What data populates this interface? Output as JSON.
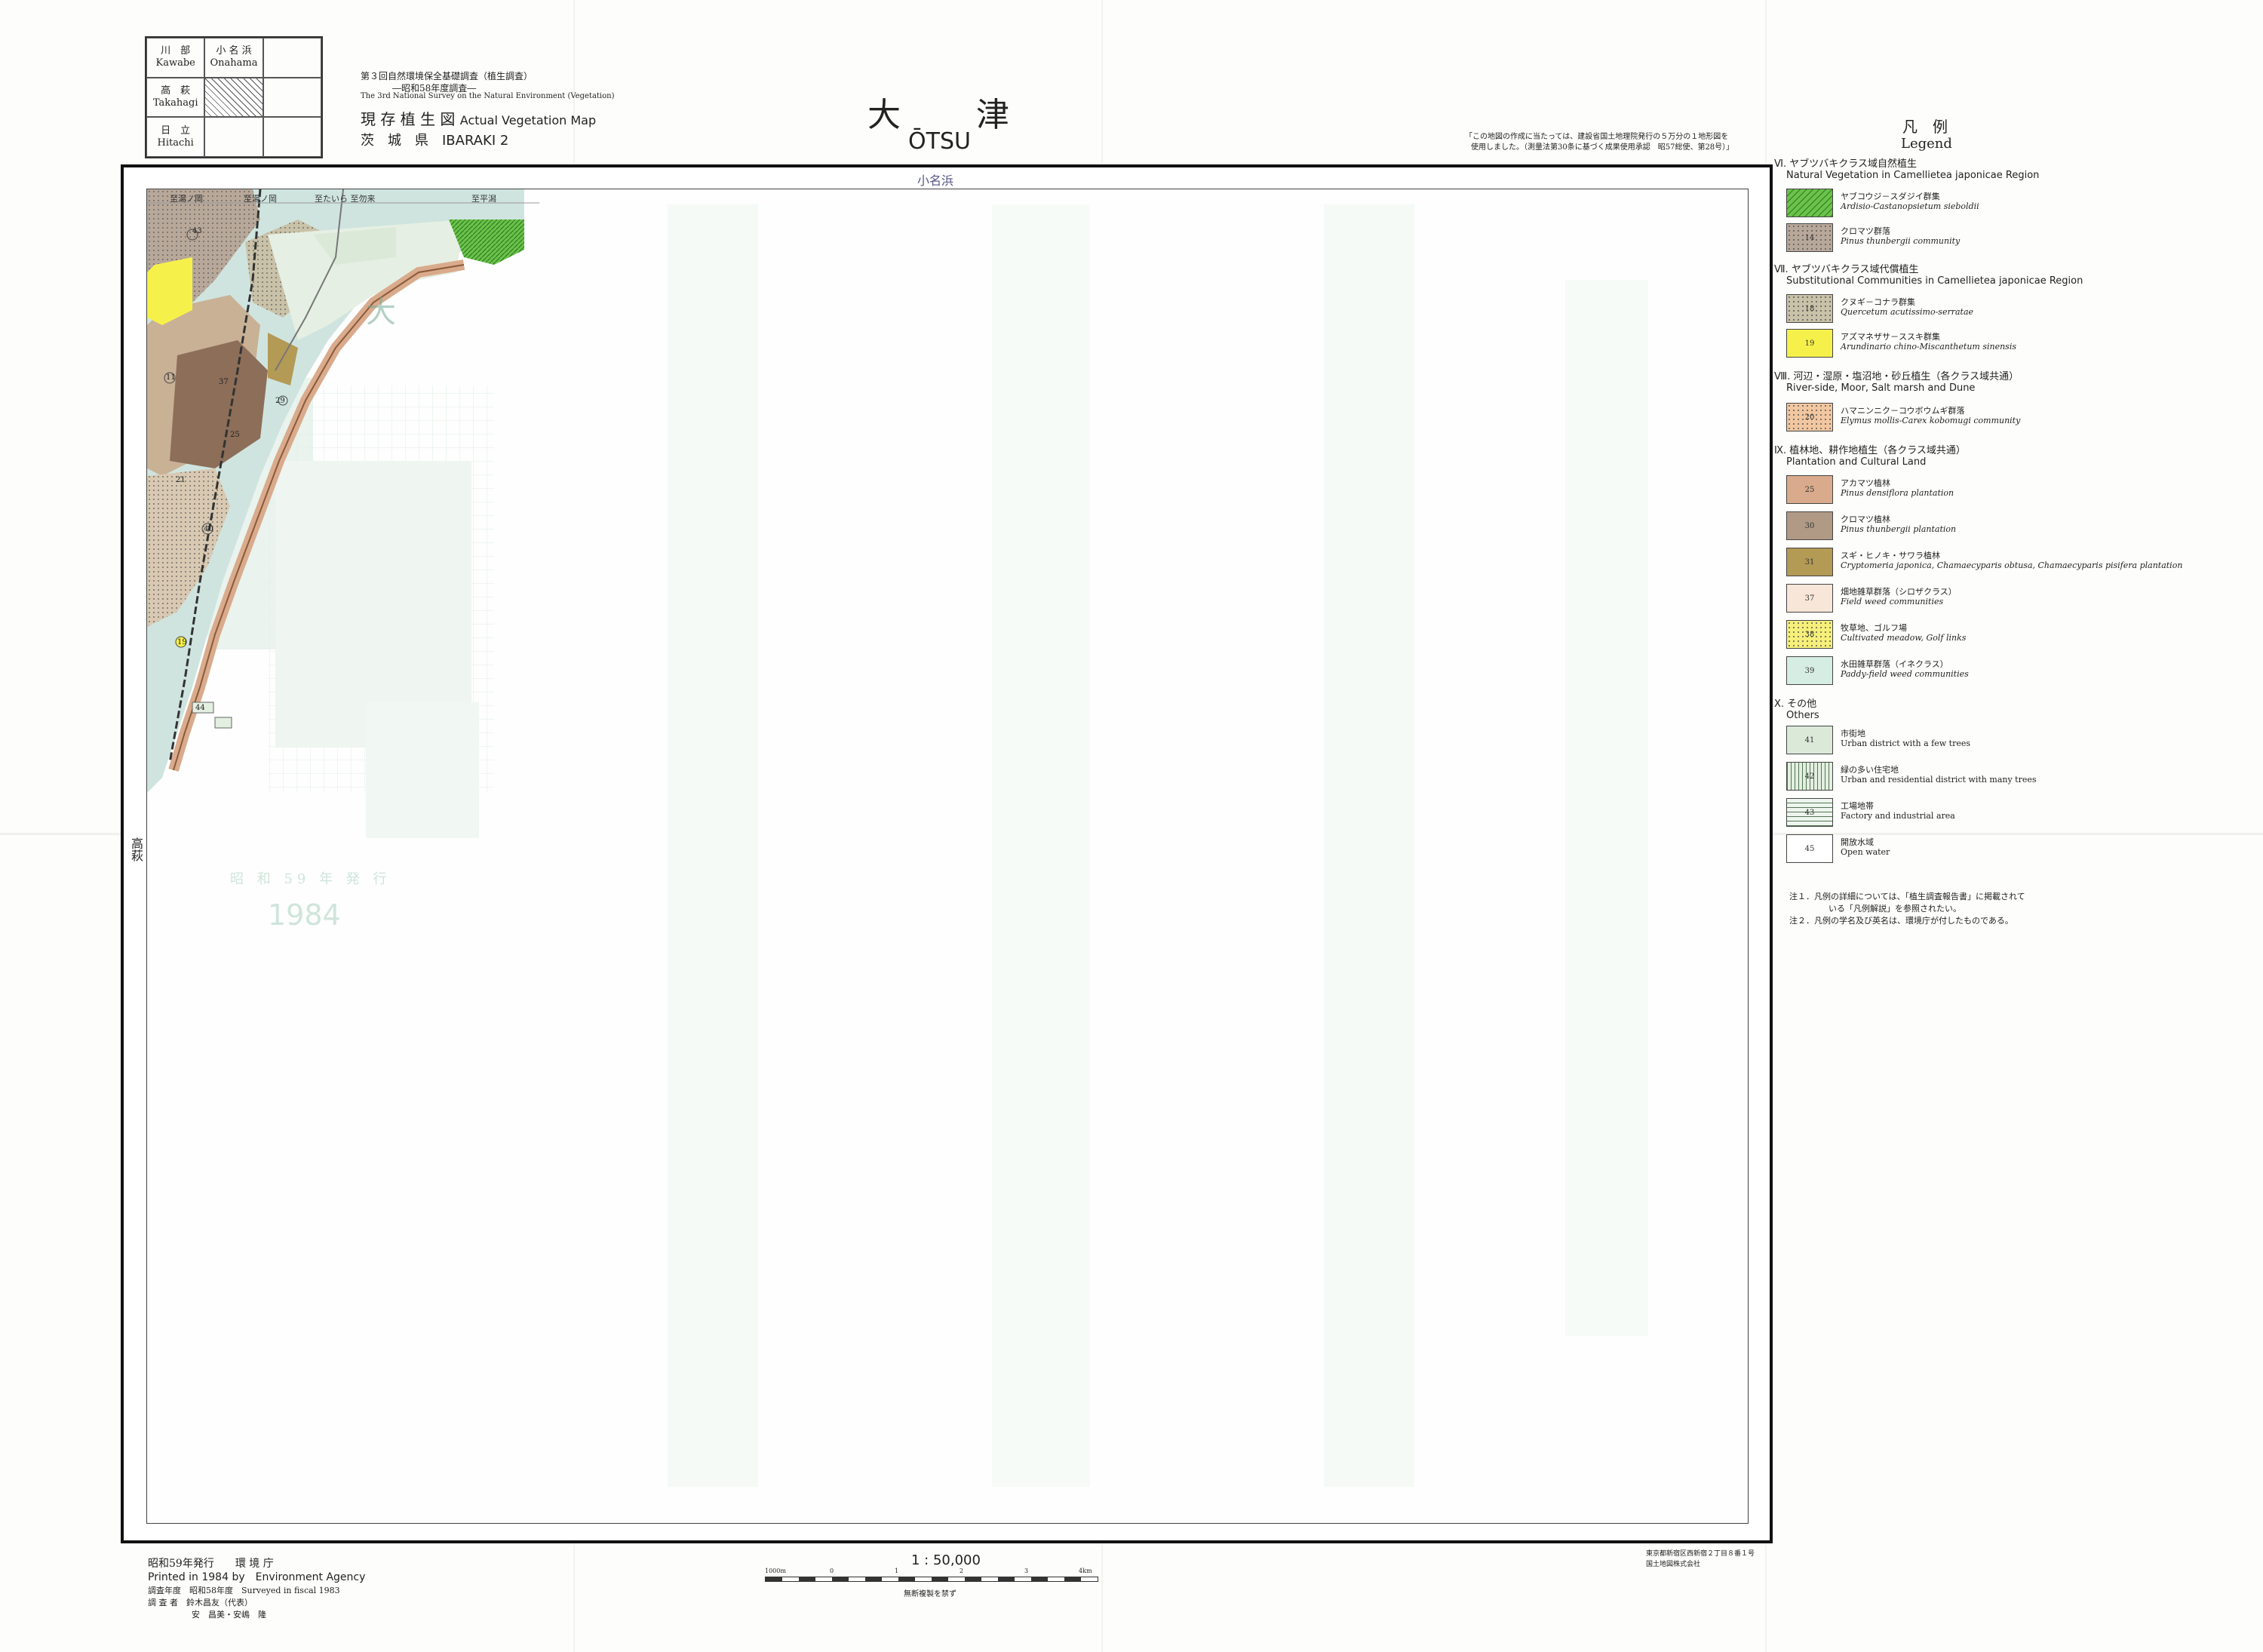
{
  "index_sheets": [
    {
      "jp": "川　部",
      "en": "Kawabe"
    },
    {
      "jp": "小 名 浜",
      "en": "Onahama"
    },
    {
      "jp": "",
      "en": ""
    },
    {
      "jp": "高　萩",
      "en": "Takahagi"
    },
    {
      "jp": "",
      "en": "",
      "current": true
    },
    {
      "jp": "",
      "en": ""
    },
    {
      "jp": "日　立",
      "en": "Hitachi"
    },
    {
      "jp": "",
      "en": ""
    },
    {
      "jp": "",
      "en": ""
    }
  ],
  "header": {
    "survey_jp": "第３回自然環境保全基礎調査（植生調査）",
    "survey_year_jp": "―昭和58年度調査―",
    "survey_en": "The 3rd National Survey on the Natural Environment (Vegetation)",
    "map_type_jp": "現 存 植 生 図",
    "map_type_en": "Actual Vegetation Map",
    "prefecture": "茨　城　県　IBARAKI 2",
    "title_jp": "大　　津",
    "title_en": "ŌTSU",
    "note_line1": "「この地図の作成に当たっては、建設省国土地理院発行の５万分の１地形図を",
    "note_line2": "使用しました。（測量法第30条に基づく成果使用承認　昭57総使、第28号）」"
  },
  "map": {
    "top_label": "小名浜",
    "left_label": "高萩",
    "place_labels": [
      "至湯ノ岡",
      "至湯ノ岡",
      "至たいら 至勿来",
      "至平潟",
      "大",
      "1984",
      "昭 和 59 年 発 行"
    ],
    "codes": [
      "43",
      "11",
      "29",
      "40",
      "37",
      "19",
      "21",
      "25",
      "44"
    ]
  },
  "legend": {
    "title_jp": "凡　例",
    "title_en": "Legend",
    "sections": [
      {
        "num_jp": "Ⅵ. ヤブツバキクラス域自然植生",
        "en": "Natural Vegetation in Camellietea japonicae Region",
        "items": [
          {
            "code": "",
            "jp": "ヤブコウジ－スダジイ群集",
            "en": "Ardisio-Castanopsietum sieboldii",
            "color": "#6cc24a",
            "pattern": "hatch"
          },
          {
            "code": "14",
            "jp": "クロマツ群落",
            "en": "Pinus thunbergii community",
            "color": "#b8a89a",
            "pattern": "dots"
          }
        ]
      },
      {
        "num_jp": "Ⅶ. ヤブツバキクラス域代償植生",
        "en": "Substitutional Communities in Camellietea japonicae Region",
        "items": [
          {
            "code": "18",
            "jp": "クヌギ－コナラ群集",
            "en": "Quercetum acutissimo-serratae",
            "color": "#c9c2a8",
            "pattern": "dots"
          },
          {
            "code": "19",
            "jp": "アズマネザサ－ススキ群集",
            "en": "Arundinario chino-Miscanthetum sinensis",
            "color": "#f6f14a",
            "pattern": "none"
          }
        ]
      },
      {
        "num_jp": "Ⅷ. 河辺・湿原・塩沼地・砂丘植生（各クラス域共通）",
        "en": "River-side, Moor, Salt marsh and Dune",
        "items": [
          {
            "code": "20",
            "jp": "ハマニンニク－コウボウムギ群落",
            "en": "Elymus mollis-Carex kobomugi community",
            "color": "#f2c7a0",
            "pattern": "dots"
          }
        ]
      },
      {
        "num_jp": "Ⅸ. 植林地、耕作地植生（各クラス域共通）",
        "en": "Plantation and Cultural Land",
        "items": [
          {
            "code": "25",
            "jp": "アカマツ植林",
            "en": "Pinus densiflora plantation",
            "color": "#d9ab8c",
            "pattern": "none"
          },
          {
            "code": "30",
            "jp": "クロマツ植林",
            "en": "Pinus thunbergii plantation",
            "color": "#b09a86",
            "pattern": "none"
          },
          {
            "code": "31",
            "jp": "スギ・ヒノキ・サワラ植林",
            "en": "Cryptomeria japonica, Chamaecyparis obtusa, Chamaecyparis pisifera plantation",
            "color": "#b39a55",
            "pattern": "none"
          },
          {
            "code": "37",
            "jp": "畑地雑草群落（シロザクラス）",
            "en": "Field weed communities",
            "color": "#f8e6d8",
            "pattern": "none"
          },
          {
            "code": "38",
            "jp": "牧草地、ゴルフ場",
            "en": "Cultivated meadow, Golf links",
            "color": "#f6f07a",
            "pattern": "dots"
          },
          {
            "code": "39",
            "jp": "水田雑草群落（イネクラス）",
            "en": "Paddy-field weed communities",
            "color": "#d6ede4",
            "pattern": "none"
          }
        ]
      },
      {
        "num_jp": "Ⅹ. その他",
        "en": "Others",
        "items": [
          {
            "code": "41",
            "jp": "市街地",
            "en": "Urban district with a few trees",
            "color": "#dbe9d9",
            "pattern": "none"
          },
          {
            "code": "42",
            "jp": "緑の多い住宅地",
            "en": "Urban and residential district with many trees",
            "color": "#e3efe0",
            "pattern": "vlines"
          },
          {
            "code": "43",
            "jp": "工場地帯",
            "en": "Factory and industrial area",
            "color": "#eef5ee",
            "pattern": "hlines"
          },
          {
            "code": "45",
            "jp": "開放水域",
            "en": "Open water",
            "color": "#ffffff",
            "pattern": "none"
          }
        ]
      }
    ],
    "note1": "注１．凡例の詳細については、「植生調査報告書」に掲載されて",
    "note1b": "いる「凡例解説」を参照されたい。",
    "note2": "注２．凡例の学名及び英名は、環境庁が付したものである。"
  },
  "footer": {
    "issued_jp": "昭和59年発行　　環 境 庁",
    "printed_en": "Printed in 1984 by　Environment Agency",
    "survey_year": "調査年度　昭和58年度　Surveyed in fiscal 1983",
    "surveyors1": "調 査 者　鈴木昌友（代表）",
    "surveyors2": "安　昌美・安嶋　隆",
    "scale": "1 : 50,000",
    "scale_ticks": [
      "1000m",
      "0",
      "1",
      "2",
      "3",
      "4km"
    ],
    "no_copy": "無断複製を禁ず",
    "printer1": "東京都新宿区西新宿２丁目８番１号",
    "printer2": "国土地図株式会社"
  }
}
